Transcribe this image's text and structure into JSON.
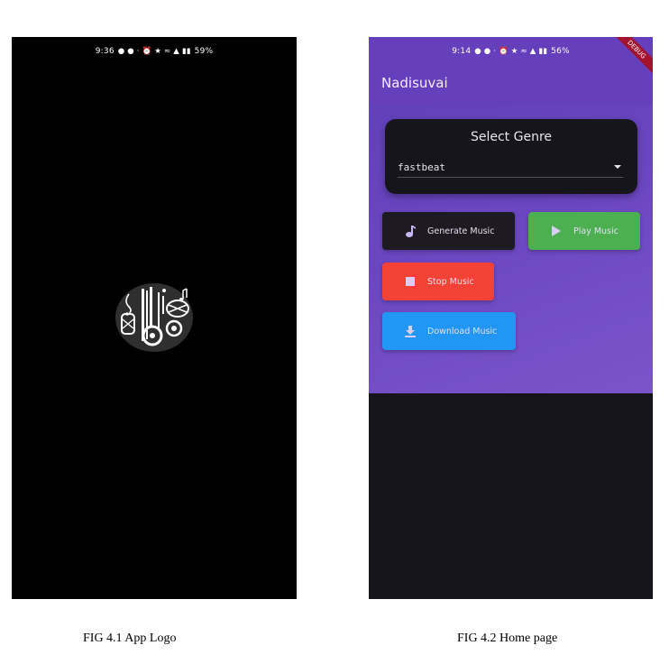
{
  "figure1": {
    "status_time": "9:36",
    "status_battery": "59%",
    "caption": "FIG 4.1 App Logo"
  },
  "figure2": {
    "status_time": "9:14",
    "status_battery": "56%",
    "app_title": "Nadisuvai",
    "debug_banner": "DEBUG",
    "genre_card": {
      "title": "Select Genre",
      "selected": "fastbeat"
    },
    "buttons": {
      "generate": "Generate Music",
      "play": "Play Music",
      "stop": "Stop Music",
      "download": "Download Music"
    },
    "caption": "FIG 4.2 Home page"
  },
  "colors": {
    "purple": "#6b46c1",
    "dark": "#17151c",
    "play_green": "#4caf50",
    "stop_red": "#f44336",
    "download_blue": "#2196f3"
  },
  "icons": [
    "music-note-icon",
    "play-icon",
    "stop-icon",
    "download-icon",
    "dropdown-arrow-icon",
    "app-logo-icon"
  ]
}
